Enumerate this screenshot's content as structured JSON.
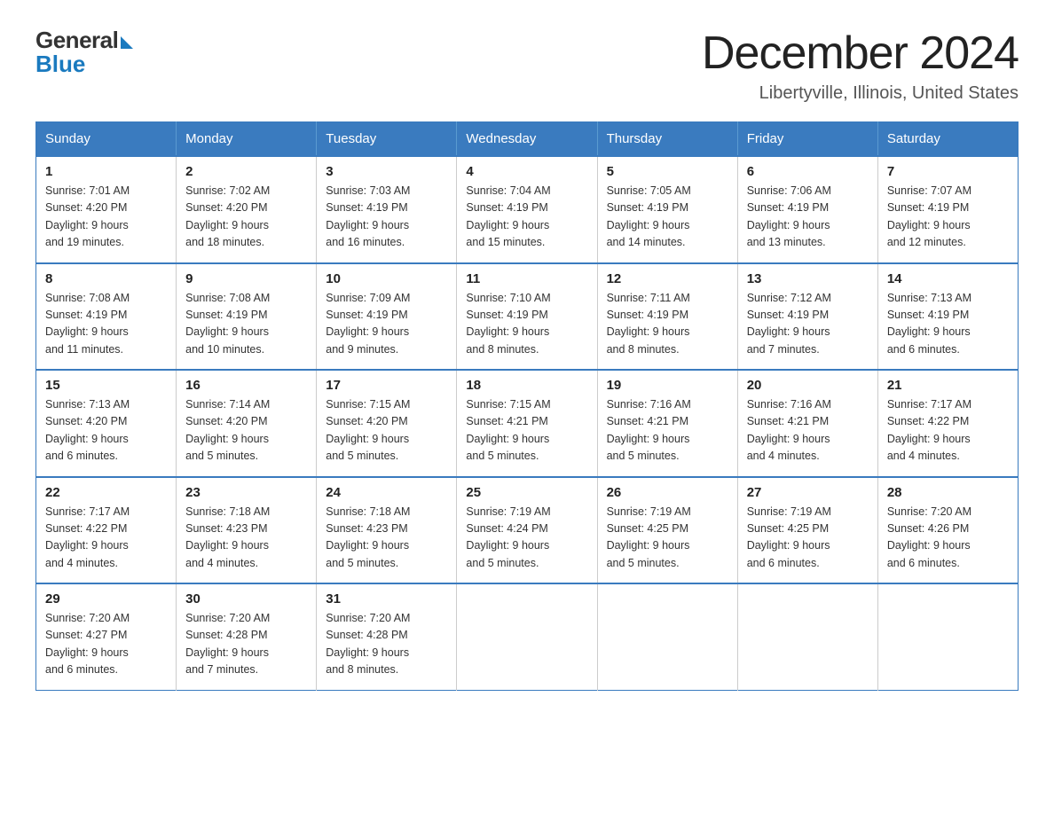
{
  "header": {
    "logo_general": "General",
    "logo_blue": "Blue",
    "month_title": "December 2024",
    "location": "Libertyville, Illinois, United States"
  },
  "days_of_week": [
    "Sunday",
    "Monday",
    "Tuesday",
    "Wednesday",
    "Thursday",
    "Friday",
    "Saturday"
  ],
  "weeks": [
    [
      {
        "day": "1",
        "sunrise": "Sunrise: 7:01 AM",
        "sunset": "Sunset: 4:20 PM",
        "daylight": "Daylight: 9 hours",
        "daylight2": "and 19 minutes."
      },
      {
        "day": "2",
        "sunrise": "Sunrise: 7:02 AM",
        "sunset": "Sunset: 4:20 PM",
        "daylight": "Daylight: 9 hours",
        "daylight2": "and 18 minutes."
      },
      {
        "day": "3",
        "sunrise": "Sunrise: 7:03 AM",
        "sunset": "Sunset: 4:19 PM",
        "daylight": "Daylight: 9 hours",
        "daylight2": "and 16 minutes."
      },
      {
        "day": "4",
        "sunrise": "Sunrise: 7:04 AM",
        "sunset": "Sunset: 4:19 PM",
        "daylight": "Daylight: 9 hours",
        "daylight2": "and 15 minutes."
      },
      {
        "day": "5",
        "sunrise": "Sunrise: 7:05 AM",
        "sunset": "Sunset: 4:19 PM",
        "daylight": "Daylight: 9 hours",
        "daylight2": "and 14 minutes."
      },
      {
        "day": "6",
        "sunrise": "Sunrise: 7:06 AM",
        "sunset": "Sunset: 4:19 PM",
        "daylight": "Daylight: 9 hours",
        "daylight2": "and 13 minutes."
      },
      {
        "day": "7",
        "sunrise": "Sunrise: 7:07 AM",
        "sunset": "Sunset: 4:19 PM",
        "daylight": "Daylight: 9 hours",
        "daylight2": "and 12 minutes."
      }
    ],
    [
      {
        "day": "8",
        "sunrise": "Sunrise: 7:08 AM",
        "sunset": "Sunset: 4:19 PM",
        "daylight": "Daylight: 9 hours",
        "daylight2": "and 11 minutes."
      },
      {
        "day": "9",
        "sunrise": "Sunrise: 7:08 AM",
        "sunset": "Sunset: 4:19 PM",
        "daylight": "Daylight: 9 hours",
        "daylight2": "and 10 minutes."
      },
      {
        "day": "10",
        "sunrise": "Sunrise: 7:09 AM",
        "sunset": "Sunset: 4:19 PM",
        "daylight": "Daylight: 9 hours",
        "daylight2": "and 9 minutes."
      },
      {
        "day": "11",
        "sunrise": "Sunrise: 7:10 AM",
        "sunset": "Sunset: 4:19 PM",
        "daylight": "Daylight: 9 hours",
        "daylight2": "and 8 minutes."
      },
      {
        "day": "12",
        "sunrise": "Sunrise: 7:11 AM",
        "sunset": "Sunset: 4:19 PM",
        "daylight": "Daylight: 9 hours",
        "daylight2": "and 8 minutes."
      },
      {
        "day": "13",
        "sunrise": "Sunrise: 7:12 AM",
        "sunset": "Sunset: 4:19 PM",
        "daylight": "Daylight: 9 hours",
        "daylight2": "and 7 minutes."
      },
      {
        "day": "14",
        "sunrise": "Sunrise: 7:13 AM",
        "sunset": "Sunset: 4:19 PM",
        "daylight": "Daylight: 9 hours",
        "daylight2": "and 6 minutes."
      }
    ],
    [
      {
        "day": "15",
        "sunrise": "Sunrise: 7:13 AM",
        "sunset": "Sunset: 4:20 PM",
        "daylight": "Daylight: 9 hours",
        "daylight2": "and 6 minutes."
      },
      {
        "day": "16",
        "sunrise": "Sunrise: 7:14 AM",
        "sunset": "Sunset: 4:20 PM",
        "daylight": "Daylight: 9 hours",
        "daylight2": "and 5 minutes."
      },
      {
        "day": "17",
        "sunrise": "Sunrise: 7:15 AM",
        "sunset": "Sunset: 4:20 PM",
        "daylight": "Daylight: 9 hours",
        "daylight2": "and 5 minutes."
      },
      {
        "day": "18",
        "sunrise": "Sunrise: 7:15 AM",
        "sunset": "Sunset: 4:21 PM",
        "daylight": "Daylight: 9 hours",
        "daylight2": "and 5 minutes."
      },
      {
        "day": "19",
        "sunrise": "Sunrise: 7:16 AM",
        "sunset": "Sunset: 4:21 PM",
        "daylight": "Daylight: 9 hours",
        "daylight2": "and 5 minutes."
      },
      {
        "day": "20",
        "sunrise": "Sunrise: 7:16 AM",
        "sunset": "Sunset: 4:21 PM",
        "daylight": "Daylight: 9 hours",
        "daylight2": "and 4 minutes."
      },
      {
        "day": "21",
        "sunrise": "Sunrise: 7:17 AM",
        "sunset": "Sunset: 4:22 PM",
        "daylight": "Daylight: 9 hours",
        "daylight2": "and 4 minutes."
      }
    ],
    [
      {
        "day": "22",
        "sunrise": "Sunrise: 7:17 AM",
        "sunset": "Sunset: 4:22 PM",
        "daylight": "Daylight: 9 hours",
        "daylight2": "and 4 minutes."
      },
      {
        "day": "23",
        "sunrise": "Sunrise: 7:18 AM",
        "sunset": "Sunset: 4:23 PM",
        "daylight": "Daylight: 9 hours",
        "daylight2": "and 4 minutes."
      },
      {
        "day": "24",
        "sunrise": "Sunrise: 7:18 AM",
        "sunset": "Sunset: 4:23 PM",
        "daylight": "Daylight: 9 hours",
        "daylight2": "and 5 minutes."
      },
      {
        "day": "25",
        "sunrise": "Sunrise: 7:19 AM",
        "sunset": "Sunset: 4:24 PM",
        "daylight": "Daylight: 9 hours",
        "daylight2": "and 5 minutes."
      },
      {
        "day": "26",
        "sunrise": "Sunrise: 7:19 AM",
        "sunset": "Sunset: 4:25 PM",
        "daylight": "Daylight: 9 hours",
        "daylight2": "and 5 minutes."
      },
      {
        "day": "27",
        "sunrise": "Sunrise: 7:19 AM",
        "sunset": "Sunset: 4:25 PM",
        "daylight": "Daylight: 9 hours",
        "daylight2": "and 6 minutes."
      },
      {
        "day": "28",
        "sunrise": "Sunrise: 7:20 AM",
        "sunset": "Sunset: 4:26 PM",
        "daylight": "Daylight: 9 hours",
        "daylight2": "and 6 minutes."
      }
    ],
    [
      {
        "day": "29",
        "sunrise": "Sunrise: 7:20 AM",
        "sunset": "Sunset: 4:27 PM",
        "daylight": "Daylight: 9 hours",
        "daylight2": "and 6 minutes."
      },
      {
        "day": "30",
        "sunrise": "Sunrise: 7:20 AM",
        "sunset": "Sunset: 4:28 PM",
        "daylight": "Daylight: 9 hours",
        "daylight2": "and 7 minutes."
      },
      {
        "day": "31",
        "sunrise": "Sunrise: 7:20 AM",
        "sunset": "Sunset: 4:28 PM",
        "daylight": "Daylight: 9 hours",
        "daylight2": "and 8 minutes."
      },
      null,
      null,
      null,
      null
    ]
  ]
}
